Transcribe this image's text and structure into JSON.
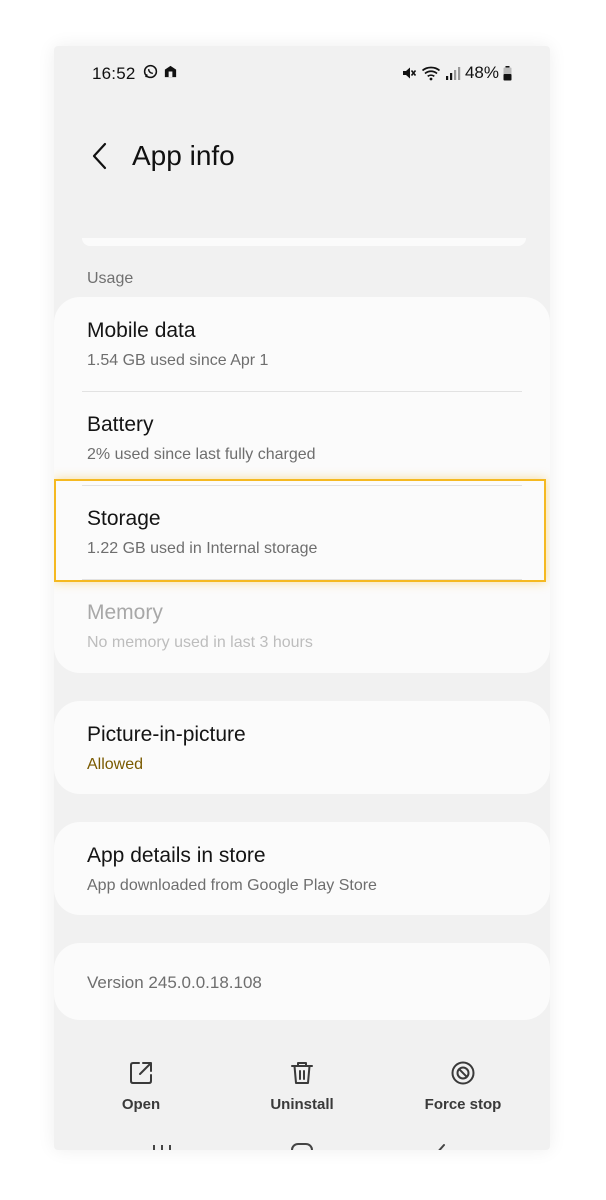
{
  "status_bar": {
    "time": "16:52",
    "battery_percent": "48%"
  },
  "header": {
    "title": "App info"
  },
  "usage": {
    "section_label": "Usage",
    "items": [
      {
        "title": "Mobile data",
        "subtitle": "1.54 GB used since Apr 1"
      },
      {
        "title": "Battery",
        "subtitle": "2% used since last fully charged"
      },
      {
        "title": "Storage",
        "subtitle": "1.22 GB used in Internal storage"
      },
      {
        "title": "Memory",
        "subtitle": "No memory used in last 3 hours"
      }
    ]
  },
  "pip": {
    "title": "Picture-in-picture",
    "subtitle": "Allowed"
  },
  "store": {
    "title": "App details in store",
    "subtitle": "App downloaded from Google Play Store"
  },
  "version": {
    "text": "Version 245.0.0.18.108"
  },
  "actions": {
    "open": "Open",
    "uninstall": "Uninstall",
    "force_stop": "Force stop"
  },
  "colors": {
    "highlight": "#f5b921",
    "allowed_text": "#7a5a00"
  }
}
